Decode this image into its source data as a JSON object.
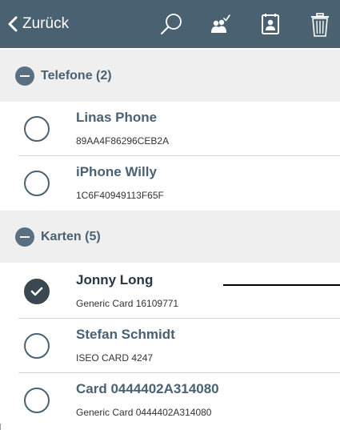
{
  "topbar": {
    "back_label": "Zurück",
    "icons": [
      "search-icon",
      "users-check-icon",
      "contact-card-icon",
      "trash-icon"
    ],
    "bg_color": "#4a6172"
  },
  "sections": [
    {
      "title": "Telefone (2)",
      "items": [
        {
          "title": "Linas Phone",
          "subtitle": "89AA4F86296CEB2A",
          "selected": false
        },
        {
          "title": "iPhone Willy",
          "subtitle": "1C6F40949113F65F",
          "selected": false
        }
      ]
    },
    {
      "title": "Karten (5)",
      "items": [
        {
          "title": "Jonny Long",
          "subtitle": "Generic Card 16109771",
          "selected": true
        },
        {
          "title": "Stefan Schmidt",
          "subtitle": "ISEO CARD 4247",
          "selected": false
        },
        {
          "title": "Card 0444402A314080",
          "subtitle": "Generic Card 0444402A314080",
          "selected": false
        }
      ]
    }
  ]
}
